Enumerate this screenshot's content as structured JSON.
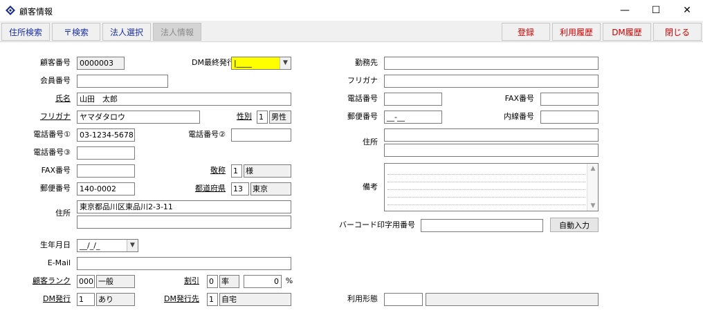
{
  "window": {
    "title": "顧客情報",
    "minimize": "—",
    "maximize": "☐",
    "close": "✕"
  },
  "toolbar": {
    "address_search": "住所検索",
    "zip_search": "〒検索",
    "corp_select": "法人選択",
    "corp_info": "法人情報",
    "register": "登録",
    "usage_history": "利用履歴",
    "dm_history": "DM履歴",
    "close": "閉じる"
  },
  "form": {
    "customer_no": {
      "label": "顧客番号",
      "value": "0000003"
    },
    "dm_last_issue": {
      "label": "DM最終発行日",
      "value": "|____"
    },
    "member_no": {
      "label": "会員番号",
      "value": ""
    },
    "name": {
      "label": "氏名",
      "value": "山田　太郎"
    },
    "furigana": {
      "label": "フリガナ",
      "value": "ヤマダタロウ"
    },
    "gender": {
      "label": "性別",
      "code": "1",
      "text": "男性"
    },
    "phone1": {
      "label": "電話番号①",
      "value": "03-1234-5678"
    },
    "phone2": {
      "label": "電話番号②",
      "value": ""
    },
    "phone3": {
      "label": "電話番号③",
      "value": ""
    },
    "fax": {
      "label": "FAX番号",
      "value": ""
    },
    "honorific": {
      "label": "敬称",
      "code": "1",
      "text": "様"
    },
    "postal": {
      "label": "郵便番号",
      "value": "140-0002"
    },
    "prefecture": {
      "label": "都道府県",
      "code": "13",
      "text": "東京"
    },
    "address": {
      "label": "住所",
      "line1": "東京都品川区東品川2-3-11",
      "line2": ""
    },
    "birthdate": {
      "label": "生年月日",
      "value": "__/_/_"
    },
    "email": {
      "label": "E-Mail",
      "value": ""
    },
    "rank": {
      "label": "顧客ランク",
      "code": "000",
      "text": "一般"
    },
    "discount": {
      "label": "割引",
      "code": "0",
      "text": "率",
      "value": "0",
      "unit": "%"
    },
    "dm_issue": {
      "label": "DM発行",
      "code": "1",
      "text": "あり"
    },
    "dm_dest": {
      "label": "DM発行先",
      "code": "1",
      "text": "自宅"
    }
  },
  "work": {
    "company": {
      "label": "勤務先",
      "value": ""
    },
    "furigana": {
      "label": "フリガナ",
      "value": ""
    },
    "phone": {
      "label": "電話番号",
      "value": ""
    },
    "fax": {
      "label": "FAX番号",
      "value": ""
    },
    "postal": {
      "label": "郵便番号",
      "value": "__-__"
    },
    "extension": {
      "label": "内線番号",
      "value": ""
    },
    "address": {
      "label": "住所",
      "line1": "",
      "line2": ""
    },
    "notes": {
      "label": "備考",
      "value": ""
    },
    "barcode": {
      "label": "バーコード印字用番号",
      "value": "",
      "auto_button": "自動入力"
    },
    "usage_type": {
      "label": "利用形態",
      "code": "",
      "text": ""
    }
  },
  "icons": {
    "app": "diamond-app-icon",
    "dropdown": "chevron-down-icon",
    "scroll_up": "scroll-up-icon",
    "scroll_down": "scroll-down-icon"
  }
}
